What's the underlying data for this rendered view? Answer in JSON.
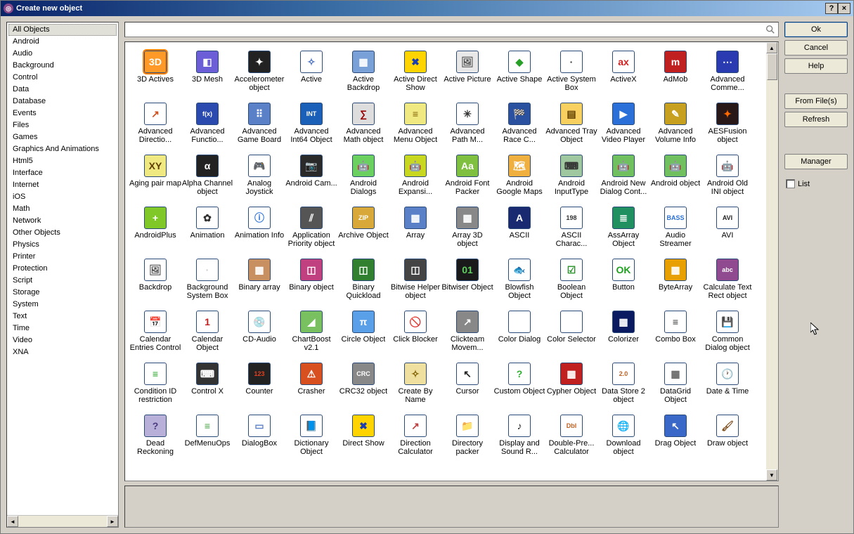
{
  "window": {
    "title": "Create new object"
  },
  "titlebar_buttons": {
    "help": "?",
    "close": "×"
  },
  "sidebar": {
    "categories": [
      "All Objects",
      "Android",
      "Audio",
      "Background",
      "Control",
      "Data",
      "Database",
      "Events",
      "Files",
      "Games",
      "Graphics And Animations",
      "Html5",
      "Interface",
      "Internet",
      "iOS",
      "Math",
      "Network",
      "Other Objects",
      "Physics",
      "Printer",
      "Protection",
      "Script",
      "Storage",
      "System",
      "Text",
      "Time",
      "Video",
      "XNA"
    ],
    "selected_index": 0
  },
  "search": {
    "value": "",
    "placeholder": ""
  },
  "objects": [
    {
      "label": "3D Actives",
      "glyph": "3D",
      "bg": "#ff9a28",
      "selected": true
    },
    {
      "label": "3D Mesh",
      "glyph": "◧",
      "bg": "#6b5ed6"
    },
    {
      "label": "Accelerometer object",
      "glyph": "✦",
      "bg": "#222"
    },
    {
      "label": "Active",
      "glyph": "✧",
      "bg": "#fff",
      "fg": "#4a70c0"
    },
    {
      "label": "Active Backdrop",
      "glyph": "▦",
      "bg": "#7aa0d8"
    },
    {
      "label": "Active Direct Show",
      "glyph": "✖",
      "bg": "#ffd400",
      "fg": "#1a3db0"
    },
    {
      "label": "Active Picture",
      "glyph": "🖼",
      "bg": "#e8e8e8",
      "fg": "#555"
    },
    {
      "label": "Active Shape",
      "glyph": "◆",
      "bg": "#fff",
      "fg": "#28a028"
    },
    {
      "label": "Active System Box",
      "glyph": "·",
      "bg": "#fff",
      "fg": "#333"
    },
    {
      "label": "ActiveX",
      "glyph": "ax",
      "bg": "#fff",
      "fg": "#d02020"
    },
    {
      "label": "AdMob",
      "glyph": "m",
      "bg": "#c02020"
    },
    {
      "label": "Advanced Comme...",
      "glyph": "⋯",
      "bg": "#2a3ab0"
    },
    {
      "label": "Advanced Directio...",
      "glyph": "↗",
      "bg": "#fff",
      "fg": "#d05020"
    },
    {
      "label": "Advanced Functio...",
      "glyph": "f(x)",
      "bg": "#2a4ab0"
    },
    {
      "label": "Advanced Game Board",
      "glyph": "⠿",
      "bg": "#5a80c8"
    },
    {
      "label": "Advanced Int64 Object",
      "glyph": "INT",
      "bg": "#1a60b8"
    },
    {
      "label": "Advanced Math object",
      "glyph": "∑",
      "bg": "#ddd",
      "fg": "#900"
    },
    {
      "label": "Advanced Menu Object",
      "glyph": "≡",
      "bg": "#f0e880",
      "fg": "#806000"
    },
    {
      "label": "Advanced Path M...",
      "glyph": "✳",
      "bg": "#fff",
      "fg": "#333"
    },
    {
      "label": "Advanced Race C...",
      "glyph": "🏁",
      "bg": "#2a50a0"
    },
    {
      "label": "Advanced Tray Object",
      "glyph": "▤",
      "bg": "#f8d060",
      "fg": "#604000"
    },
    {
      "label": "Advanced Video Player",
      "glyph": "▶",
      "bg": "#2a70d8"
    },
    {
      "label": "Advanced Volume Info",
      "glyph": "✎",
      "bg": "#c8a020"
    },
    {
      "label": "AESFusion object",
      "glyph": "✦",
      "bg": "#281818",
      "fg": "#ff6a00"
    },
    {
      "label": "Aging pair map",
      "glyph": "XY",
      "bg": "#f0e880",
      "fg": "#604000"
    },
    {
      "label": "Alpha Channel object",
      "glyph": "α",
      "bg": "#222"
    },
    {
      "label": "Analog Joystick",
      "glyph": "🎮",
      "bg": "#fff",
      "fg": "#222"
    },
    {
      "label": "Android Cam...",
      "glyph": "📷",
      "bg": "#2a2a2a",
      "fg": "#6ad060"
    },
    {
      "label": "Android Dialogs",
      "glyph": "🤖",
      "bg": "#6ad060",
      "fg": "#fff"
    },
    {
      "label": "Android Expansi...",
      "glyph": "🤖",
      "bg": "#c8d820",
      "fg": "#404000"
    },
    {
      "label": "Android Font Packer",
      "glyph": "Aa",
      "bg": "#80c040"
    },
    {
      "label": "Android Google Maps",
      "glyph": "🗺",
      "bg": "#f0b040"
    },
    {
      "label": "Android InputType",
      "glyph": "⌨",
      "bg": "#a0c8a0",
      "fg": "#333"
    },
    {
      "label": "Android New Dialog Cont...",
      "glyph": "🤖",
      "bg": "#70c060"
    },
    {
      "label": "Android object",
      "glyph": "🤖",
      "bg": "#70c060"
    },
    {
      "label": "Android Old INI object",
      "glyph": "🤖",
      "bg": "#fff",
      "fg": "#70c060"
    },
    {
      "label": "AndroidPlus",
      "glyph": "+",
      "bg": "#80c828"
    },
    {
      "label": "Animation",
      "glyph": "✿",
      "bg": "#fff",
      "fg": "#333"
    },
    {
      "label": "Animation Info",
      "glyph": "ⓘ",
      "bg": "#fff",
      "fg": "#2a70d8"
    },
    {
      "label": "Application Priority object",
      "glyph": "⫽",
      "bg": "#555"
    },
    {
      "label": "Archive Object",
      "glyph": "ZIP",
      "bg": "#d8a838"
    },
    {
      "label": "Array",
      "glyph": "▦",
      "bg": "#5a80c8"
    },
    {
      "label": "Array 3D object",
      "glyph": "▦",
      "bg": "#888"
    },
    {
      "label": "ASCII",
      "glyph": "A",
      "bg": "#1a2a70"
    },
    {
      "label": "ASCII Charac...",
      "glyph": "198",
      "bg": "#fff",
      "fg": "#333"
    },
    {
      "label": "AssArray Object",
      "glyph": "≣",
      "bg": "#209060"
    },
    {
      "label": "Audio Streamer",
      "glyph": "BASS",
      "bg": "#fff",
      "fg": "#2a70d8"
    },
    {
      "label": "AVI",
      "glyph": "AVI",
      "bg": "#fff",
      "fg": "#222"
    },
    {
      "label": "Backdrop",
      "glyph": "🖼",
      "bg": "#fff",
      "fg": "#555"
    },
    {
      "label": "Background System Box",
      "glyph": "·",
      "bg": "#fff",
      "fg": "#ccc"
    },
    {
      "label": "Binary array",
      "glyph": "▦",
      "bg": "#c89060"
    },
    {
      "label": "Binary object",
      "glyph": "◫",
      "bg": "#c04080"
    },
    {
      "label": "Binary Quickload",
      "glyph": "◫",
      "bg": "#308030"
    },
    {
      "label": "Bitwise Helper object",
      "glyph": "◫",
      "bg": "#444"
    },
    {
      "label": "Bitwiser Object",
      "glyph": "01",
      "bg": "#1a1a1a",
      "fg": "#60d060"
    },
    {
      "label": "Blowfish Object",
      "glyph": "🐟",
      "bg": "#fff",
      "fg": "#e8a000"
    },
    {
      "label": "Boolean Object",
      "glyph": "☑",
      "bg": "#fff",
      "fg": "#209020"
    },
    {
      "label": "Button",
      "glyph": "OK",
      "bg": "#fff",
      "fg": "#20a020"
    },
    {
      "label": "ByteArray",
      "glyph": "▦",
      "bg": "#e8a000"
    },
    {
      "label": "Calculate Text Rect object",
      "glyph": "abc",
      "bg": "#904a90"
    },
    {
      "label": "Calendar Entries Control",
      "glyph": "📅",
      "bg": "#fff",
      "fg": "#3a70c0"
    },
    {
      "label": "Calendar Object",
      "glyph": "1",
      "bg": "#fff",
      "fg": "#c02020"
    },
    {
      "label": "CD-Audio",
      "glyph": "💿",
      "bg": "#fff",
      "fg": "#888"
    },
    {
      "label": "ChartBoost v2.1",
      "glyph": "◢",
      "bg": "#78c060"
    },
    {
      "label": "Circle Object",
      "glyph": "π",
      "bg": "#5aa0e8"
    },
    {
      "label": "Click Blocker",
      "glyph": "🚫",
      "bg": "#fff",
      "fg": "#888"
    },
    {
      "label": "Clickteam Movem...",
      "glyph": "↗",
      "bg": "#888"
    },
    {
      "label": "Color Dialog",
      "glyph": "▦",
      "bg": "#fff"
    },
    {
      "label": "Color Selector",
      "glyph": "▦",
      "bg": "#fff"
    },
    {
      "label": "Colorizer",
      "glyph": "▦",
      "bg": "#0a1a60"
    },
    {
      "label": "Combo Box",
      "glyph": "≡",
      "bg": "#fff",
      "fg": "#333"
    },
    {
      "label": "Common Dialog object",
      "glyph": "💾",
      "bg": "#fff",
      "fg": "#2a50a0"
    },
    {
      "label": "Condition ID restriction",
      "glyph": "≡",
      "bg": "#fff",
      "fg": "#20a020"
    },
    {
      "label": "Control X",
      "glyph": "⌨",
      "bg": "#333"
    },
    {
      "label": "Counter",
      "glyph": "123",
      "bg": "#222",
      "fg": "#e04020"
    },
    {
      "label": "Crasher",
      "glyph": "⚠",
      "bg": "#d85020"
    },
    {
      "label": "CRC32 object",
      "glyph": "CRC",
      "bg": "#888"
    },
    {
      "label": "Create By Name",
      "glyph": "✧",
      "bg": "#f0e0a0",
      "fg": "#806000"
    },
    {
      "label": "Cursor",
      "glyph": "↖",
      "bg": "#fff",
      "fg": "#222"
    },
    {
      "label": "Custom Object",
      "glyph": "?",
      "bg": "#fff",
      "fg": "#30b030"
    },
    {
      "label": "Cypher Object",
      "glyph": "▦",
      "bg": "#c02020"
    },
    {
      "label": "Data Store 2 object",
      "glyph": "2.0",
      "bg": "#fff",
      "fg": "#c06020"
    },
    {
      "label": "DataGrid Object",
      "glyph": "▦",
      "bg": "#fff",
      "fg": "#666"
    },
    {
      "label": "Date & Time",
      "glyph": "🕐",
      "bg": "#fff",
      "fg": "#2a50a0"
    },
    {
      "label": "Dead Reckoning",
      "glyph": "?",
      "bg": "#b8b0d8",
      "fg": "#4a3a80"
    },
    {
      "label": "DefMenuOps",
      "glyph": "≡",
      "bg": "#fff",
      "fg": "#40a040"
    },
    {
      "label": "DialogBox",
      "glyph": "▭",
      "bg": "#fff",
      "fg": "#5a80c8"
    },
    {
      "label": "Dictionary Object",
      "glyph": "📘",
      "bg": "#fff",
      "fg": "#2a50a0"
    },
    {
      "label": "Direct Show",
      "glyph": "✖",
      "bg": "#ffd400",
      "fg": "#1a3db0"
    },
    {
      "label": "Direction Calculator",
      "glyph": "↗",
      "bg": "#fff",
      "fg": "#c04040"
    },
    {
      "label": "Directory packer",
      "glyph": "📁",
      "bg": "#fff",
      "fg": "#806020"
    },
    {
      "label": "Display and Sound R...",
      "glyph": "♪",
      "bg": "#fff",
      "fg": "#222"
    },
    {
      "label": "Double-Pre... Calculator",
      "glyph": "Dbl",
      "bg": "#fff",
      "fg": "#c06020"
    },
    {
      "label": "Download object",
      "glyph": "🌐",
      "bg": "#fff",
      "fg": "#2a70d8"
    },
    {
      "label": "Drag Object",
      "glyph": "↖",
      "bg": "#3a68c8"
    },
    {
      "label": "Draw object",
      "glyph": "🖌",
      "bg": "#fff",
      "fg": "#805020"
    }
  ],
  "buttons": {
    "ok": "Ok",
    "cancel": "Cancel",
    "help": "Help",
    "from_files": "From File(s)",
    "refresh": "Refresh",
    "manager": "Manager"
  },
  "checkbox": {
    "list_label": "List",
    "checked": false
  }
}
